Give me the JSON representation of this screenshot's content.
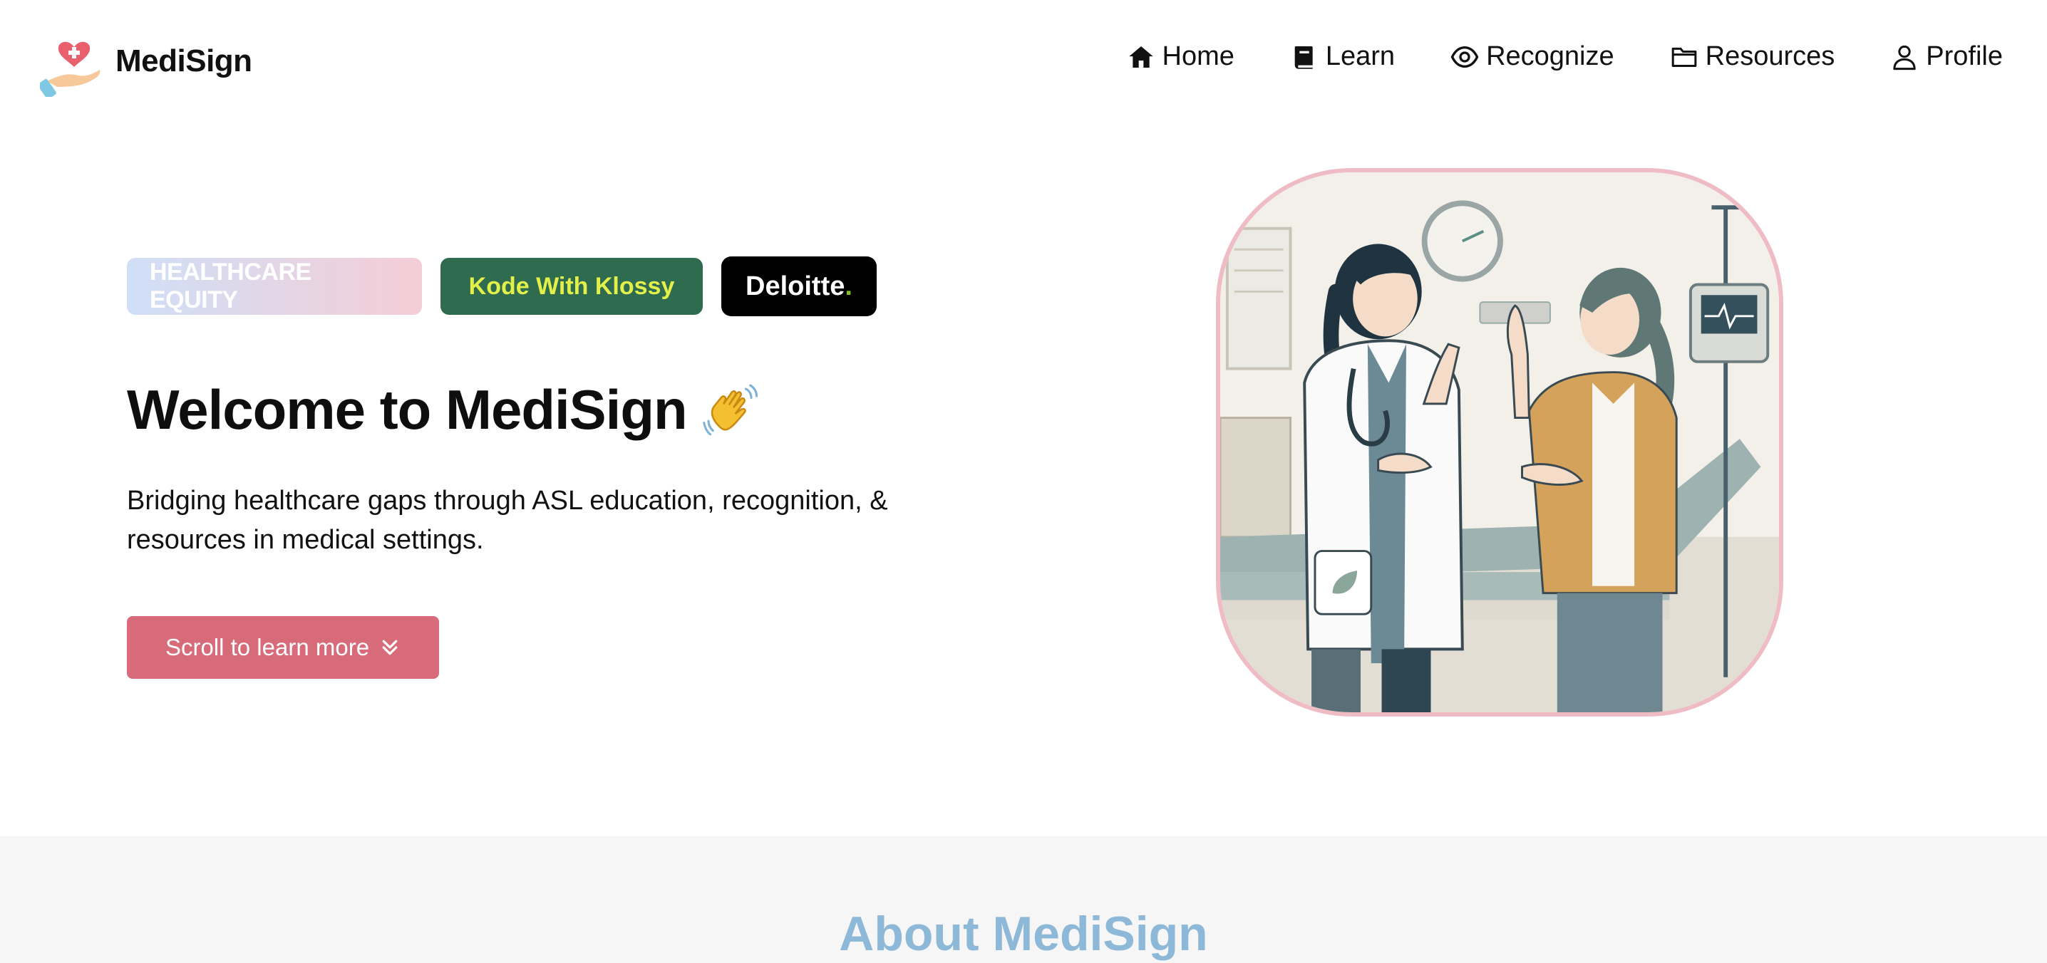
{
  "brand": {
    "name": "MediSign"
  },
  "nav": {
    "items": [
      {
        "label": "Home",
        "icon": "home-icon"
      },
      {
        "label": "Learn",
        "icon": "book-icon"
      },
      {
        "label": "Recognize",
        "icon": "eye-icon"
      },
      {
        "label": "Resources",
        "icon": "folder-icon"
      },
      {
        "label": "Profile",
        "icon": "user-icon"
      }
    ]
  },
  "hero": {
    "badges": {
      "equity": "HEALTHCARE EQUITY",
      "klossy": "Kode With Klossy",
      "deloitte": "Deloitte",
      "deloitte_dot": "."
    },
    "title": "Welcome to MediSign",
    "title_emoji": "waving-hand-icon",
    "text": "Bridging healthcare gaps through ASL education, recognition, & resources in medical settings.",
    "cta_label": "Scroll to learn more",
    "cta_icon": "double-chevron-down-icon",
    "image": "doctor-patient-sign-language-illustration"
  },
  "about": {
    "title": "About MediSign"
  },
  "colors": {
    "accent": "#d86b79",
    "about_title": "#8db8d8",
    "klossy_bg": "#2f6b4f",
    "klossy_text": "#e4f04a",
    "image_border": "#efbcc6"
  }
}
